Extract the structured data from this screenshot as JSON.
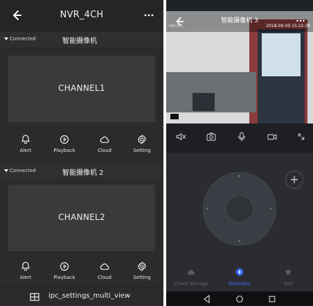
{
  "left": {
    "topbar": {
      "title": "NVR_4CH"
    },
    "devices": [
      {
        "status": "Connected",
        "name": "智能摄像机",
        "channel": "CHANNEL1",
        "actions": [
          {
            "label": "Alert",
            "icon": "bell-icon"
          },
          {
            "label": "Playback",
            "icon": "playback-icon"
          },
          {
            "label": "Cloud",
            "icon": "cloud-icon"
          },
          {
            "label": "Setting",
            "icon": "gear-icon"
          }
        ]
      },
      {
        "status": "Connected",
        "name": "智能摄像机 2",
        "channel": "CHANNEL2",
        "actions": [
          {
            "label": "Alert",
            "icon": "bell-icon"
          },
          {
            "label": "Playback",
            "icon": "playback-icon"
          },
          {
            "label": "Cloud",
            "icon": "cloud-icon"
          },
          {
            "label": "Setting",
            "icon": "gear-icon"
          }
        ]
      }
    ],
    "bottombar": {
      "label": "ipc_settings_multi_view",
      "icon": "grid-icon"
    }
  },
  "right": {
    "header": {
      "title": "智能摄像机 3",
      "mode": "HD-IPC",
      "timestamp": "2018-09-09 15:22:38"
    },
    "toolbar": [
      {
        "icon": "mute-icon"
      },
      {
        "icon": "snapshot-icon"
      },
      {
        "icon": "mic-icon"
      },
      {
        "icon": "record-icon"
      },
      {
        "icon": "fullscreen-icon"
      }
    ],
    "ptz": {
      "center_label": "",
      "plus_icon": "plus-icon"
    },
    "tabs": [
      {
        "label": "Cloud Storage",
        "icon": "cloud-storage-icon",
        "active": false
      },
      {
        "label": "Direction",
        "icon": "direction-icon",
        "active": true
      },
      {
        "label": "Vsit",
        "icon": "star-icon",
        "active": false
      }
    ],
    "system_nav": [
      {
        "icon": "back-triangle-icon"
      },
      {
        "icon": "home-circle-icon"
      },
      {
        "icon": "recent-square-icon"
      }
    ]
  },
  "colors": {
    "left_bg": "#2b2b2b",
    "right_bg": "#1f2226",
    "active_tab": "#3d6cff"
  }
}
